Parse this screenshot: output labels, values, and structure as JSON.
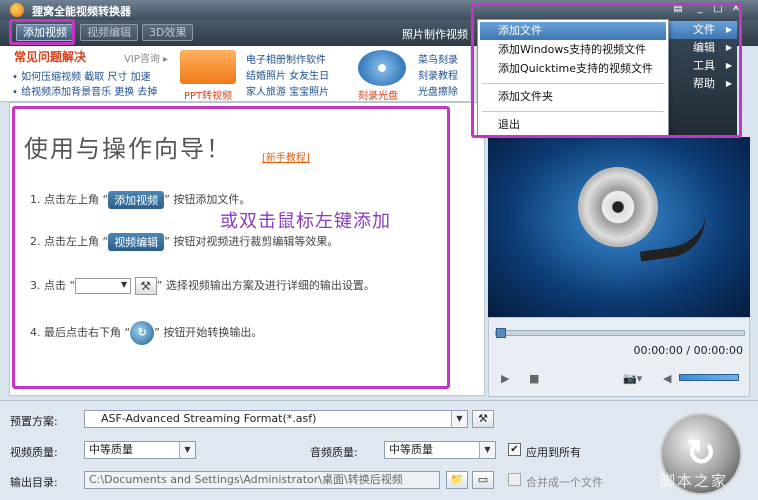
{
  "app": {
    "title": "狸窝全能视频转换器"
  },
  "toolbar": {
    "add_video": "添加视频",
    "edit_video": "视频编辑",
    "effect_3d": "3D效果",
    "right_text": "照片制作视频"
  },
  "ad": {
    "title": "常见问题解决",
    "vip": "VIP咨询 ▸",
    "line1": "• 如何压缩视频  截取  尺寸  加速",
    "line2": "• 给视频添加背景音乐  更换  去掉",
    "ppt_label": "PPT转视频",
    "col2_line1": "电子相册制作软件",
    "col2_line2": "结婚照片  女友生日",
    "col2_line3": "家人旅游  宝宝照片",
    "cd_label": "刻录光盘",
    "col3_line1": "菜鸟刻录",
    "col3_line2": "刻录教程",
    "col3_line3": "光盘擦除"
  },
  "guide": {
    "title": "使用与操作向导！",
    "tutorial_link": "[新手教程]",
    "overlay": "或双击鼠标左键添加",
    "step1_pre": "1. 点击左上角 “",
    "step1_btn": "添加视频",
    "step1_post": "” 按钮添加文件。",
    "step2_pre": "2. 点击左上角 “",
    "step2_btn": "视频编辑",
    "step2_post": "” 按钮对视频进行裁剪编辑等效果。",
    "step3_pre": "3. 点击 “",
    "step3_post": "” 选择视频输出方案及进行详细的输出设置。",
    "step4_pre": "4. 最后点击右下角 “",
    "step4_post": "” 按钮开始转换输出。"
  },
  "player": {
    "time": "00:00:00 / 00:00:00",
    "progress": 0
  },
  "settings": {
    "preset_label": "预置方案:",
    "preset_value": "ASF-Advanced Streaming Format(*.asf)",
    "video_quality_label": "视频质量:",
    "video_quality_value": "中等质量",
    "audio_quality_label": "音频质量:",
    "audio_quality_value": "中等质量",
    "apply_all": "应用到所有",
    "output_label": "输出目录:",
    "output_value": "C:\\Documents and Settings\\Administrator\\桌面\\转换后视频",
    "merge": "合并成一个文件"
  },
  "menu": {
    "main": [
      {
        "label": "文件"
      },
      {
        "label": "编辑"
      },
      {
        "label": "工具"
      },
      {
        "label": "帮助"
      }
    ],
    "file_items": [
      {
        "label": "添加文件"
      },
      {
        "label": "添加Windows支持的视频文件"
      },
      {
        "label": "添加Quicktime支持的视频文件"
      },
      {
        "label": "添加文件夹"
      },
      {
        "label": "退出"
      }
    ]
  },
  "watermark": "脚本之家"
}
